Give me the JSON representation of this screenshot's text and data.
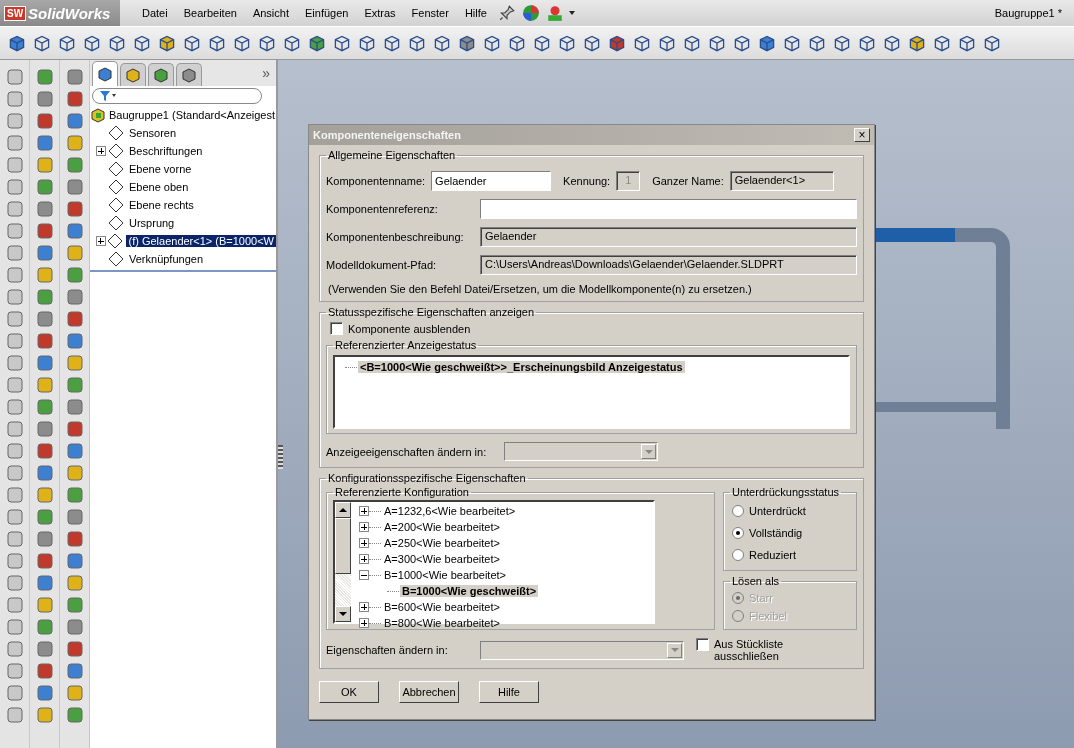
{
  "app": {
    "logo_mark": "SW",
    "logo": "SolidWorks",
    "menu": [
      "Datei",
      "Bearbeiten",
      "Ansicht",
      "Einfügen",
      "Extras",
      "Fenster",
      "Hilfe"
    ],
    "document_title": "Baugruppe1 *"
  },
  "tree": {
    "tabs": [
      {
        "selected": true
      },
      {
        "selected": false
      },
      {
        "selected": false
      },
      {
        "selected": false
      }
    ],
    "more": "»",
    "root": "Baugruppe1  (Standard<Anzeigest",
    "items": [
      {
        "label": "Sensoren",
        "expandable": false,
        "selected": false
      },
      {
        "label": "Beschriftungen",
        "expandable": true,
        "selected": false
      },
      {
        "label": "Ebene vorne",
        "expandable": false,
        "selected": false
      },
      {
        "label": "Ebene oben",
        "expandable": false,
        "selected": false
      },
      {
        "label": "Ebene rechts",
        "expandable": false,
        "selected": false
      },
      {
        "label": "Ursprung",
        "expandable": false,
        "selected": false
      },
      {
        "label": "(f) Gelaender<1> (B=1000<W",
        "expandable": true,
        "selected": true
      },
      {
        "label": "Verknüpfungen",
        "expandable": false,
        "selected": false
      }
    ]
  },
  "dialog": {
    "title": "Komponenteneigenschaften",
    "close": "×",
    "general": {
      "legend": "Allgemeine Eigenschaften",
      "name_label": "Komponentenname:",
      "name_value": "Gelaender",
      "id_label": "Kennung:",
      "id_value": "1",
      "full_name_label": "Ganzer Name:",
      "full_name_value": "Gelaender<1>",
      "reference_label": "Komponentenreferenz:",
      "description_label": "Komponentenbeschreibung:",
      "description_value": "Gelaender",
      "path_label": "Modelldokument-Pfad:",
      "path_value": "C:\\Users\\Andreas\\Downloads\\Gelaender\\Gelaender.SLDPRT",
      "note": "(Verwenden Sie den Befehl Datei/Ersetzen, um die Modellkomponente(n) zu ersetzen.)"
    },
    "display": {
      "legend": "Statusspezifische Eigenschaften anzeigen",
      "hide": {
        "label": "Komponente ausblenden",
        "checked": false
      },
      "states_legend": "Referenzierter Anzeigestatus",
      "states": [
        {
          "label": "<B=1000<Wie geschweißt>>_Erscheinungsbild Anzeigestatus",
          "selected": true
        }
      ],
      "change_label": "Anzeigeeigenschaften ändern in:"
    },
    "config": {
      "legend": "Konfigurationsspezifische Eigenschaften",
      "ref_legend": "Referenzierte Konfiguration",
      "items": [
        {
          "label": "A=1232,6<Wie bearbeitet>",
          "expanded": false,
          "selected": false
        },
        {
          "label": "A=200<Wie bearbeitet>",
          "expanded": false,
          "selected": false
        },
        {
          "label": "A=250<Wie bearbeitet>",
          "expanded": false,
          "selected": false
        },
        {
          "label": "A=300<Wie bearbeitet>",
          "expanded": false,
          "selected": false
        },
        {
          "label": "B=1000<Wie bearbeitet>",
          "expanded": true,
          "selected": false,
          "children": [
            {
              "label": "B=1000<Wie geschweißt>",
              "selected": true
            }
          ]
        },
        {
          "label": "B=600<Wie bearbeitet>",
          "expanded": false,
          "selected": false
        },
        {
          "label": "B=800<Wie bearbeitet>",
          "expanded": false,
          "selected": false
        }
      ],
      "suppression": {
        "legend": "Unterdrückungsstatus",
        "options": [
          {
            "label": "Unterdrückt",
            "selected": false
          },
          {
            "label": "Vollständig",
            "selected": true
          },
          {
            "label": "Reduziert",
            "selected": false
          }
        ]
      },
      "solve": {
        "legend": "Lösen als",
        "disabled": true,
        "options": [
          {
            "label": "Starr",
            "selected": true
          },
          {
            "label": "Flexibel",
            "selected": false
          }
        ]
      },
      "change_label": "Eigenschaften ändern in:",
      "exclude": {
        "label": "Aus Stückliste ausschließen",
        "checked": false
      }
    },
    "buttons": [
      "OK",
      "Abbrechen",
      "Hilfe"
    ]
  }
}
